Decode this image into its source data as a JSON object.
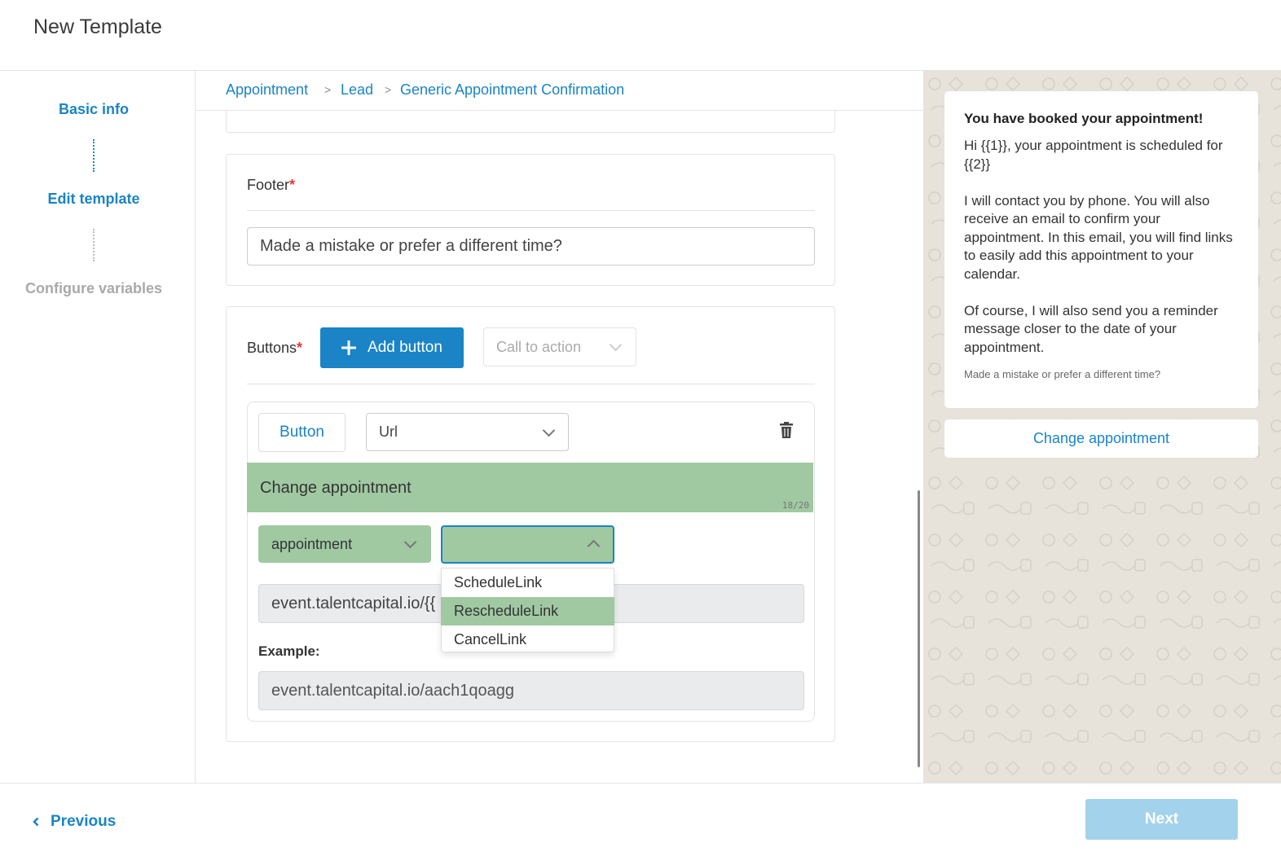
{
  "header": {
    "title": "New Template"
  },
  "sidebar": {
    "steps": [
      {
        "label": "Basic info"
      },
      {
        "label": "Edit template"
      },
      {
        "label": "Configure variables"
      }
    ]
  },
  "breadcrumb": [
    "Appointment",
    "Lead",
    "Generic Appointment Confirmation"
  ],
  "breadcrumb_separator": ">",
  "footer_section": {
    "label": "Footer",
    "required_mark": "*",
    "value": "Made a mistake or prefer a different time?"
  },
  "buttons_section": {
    "label": "Buttons",
    "required_mark": "*",
    "add_button_label": "Add button",
    "add_button_icon": "plus-icon",
    "type_select_placeholder": "Call to action",
    "item": {
      "type_label": "Button",
      "kind_value": "Url",
      "delete_icon": "trash-icon",
      "text_value": "Change appointment",
      "char_count": "18/20",
      "url_var1": "appointment",
      "url_var2": "",
      "url_value": "event.talentcapital.io/{{",
      "example_label": "Example:",
      "example_value": "event.talentcapital.io/aach1qoagg"
    },
    "dropdown_options": [
      "ScheduleLink",
      "RescheduleLink",
      "CancelLink"
    ],
    "dropdown_highlighted": "RescheduleLink"
  },
  "preview": {
    "header": "You have booked your appointment!",
    "body": "Hi {{1}}, your appointment is scheduled for {{2}}\n\nI will contact you by phone. You will also receive an email to confirm your appointment. In this email, you will find links to easily add this appointment to your calendar.\n\nOf course, I will also send you a reminder message closer to the date of your appointment.",
    "footer": "Made a mistake or prefer a different time?",
    "button": "Change appointment"
  },
  "nav": {
    "previous_label": "Previous",
    "next_label": "Next"
  },
  "colors": {
    "accent": "#1a84c6",
    "highlight_green": "#a0c9a2",
    "required": "#e53935",
    "next_disabled": "#a3d2ec",
    "preview_bg": "#e7e2da"
  }
}
